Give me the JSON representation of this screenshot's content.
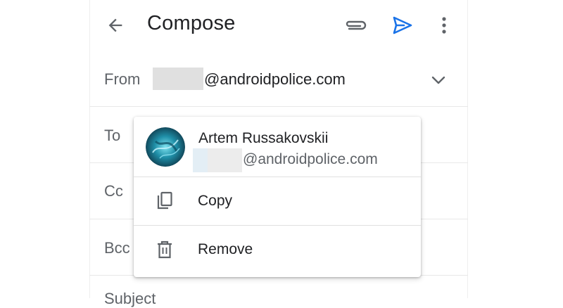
{
  "appbar": {
    "title": "Compose",
    "icons": {
      "back": "arrow-back-icon",
      "attach": "paperclip-icon",
      "send": "send-icon",
      "more": "more-vert-icon"
    },
    "send_color": "#1a73e8"
  },
  "fields": {
    "from_label": "From",
    "from_value": "@androidpolice.com",
    "to_label": "To",
    "cc_label": "Cc",
    "bcc_label": "Bcc",
    "subject_label": "Subject"
  },
  "contact_popup": {
    "name": "Artem Russakovskii",
    "email": "@androidpolice.com",
    "menu": [
      {
        "label": "Copy",
        "icon": "copy-icon"
      },
      {
        "label": "Remove",
        "icon": "delete-icon"
      }
    ]
  }
}
